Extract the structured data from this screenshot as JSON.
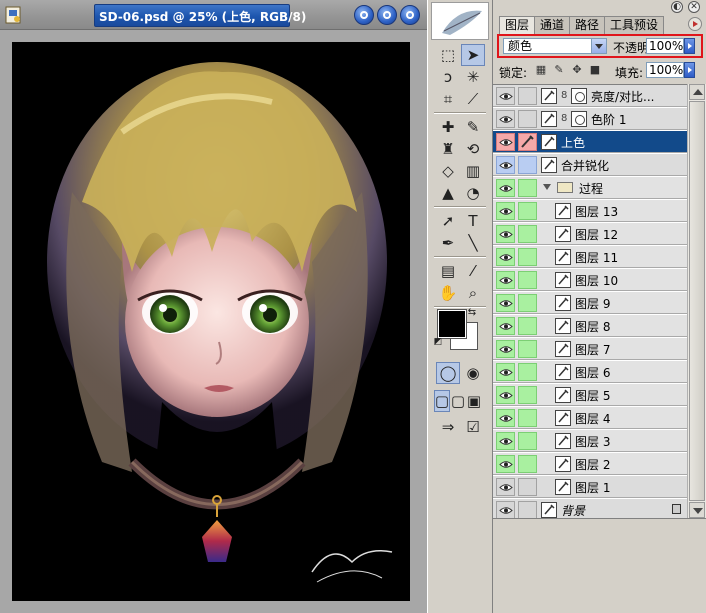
{
  "document": {
    "title": "SD-06.psd @ 25% (上色, RGB/8)"
  },
  "panel": {
    "tabs": [
      {
        "label": "图层"
      },
      {
        "label": "通道"
      },
      {
        "label": "路径"
      },
      {
        "label": "工具预设"
      }
    ],
    "blend_mode": "颜色",
    "opacity_label": "不透明度:",
    "opacity_value": "100%",
    "lock_label": "锁定:",
    "fill_label": "填充:",
    "fill_value": "100%"
  },
  "layers": [
    {
      "name": "亮度/对比...",
      "kind": "adjustment",
      "state": "plain"
    },
    {
      "name": "色阶 1",
      "kind": "adjustment",
      "state": "plain"
    },
    {
      "name": "上色",
      "kind": "layer",
      "state": "selected"
    },
    {
      "name": "合并锐化",
      "kind": "layer",
      "state": "blue"
    },
    {
      "name": "过程",
      "kind": "group",
      "state": "green"
    },
    {
      "name": "图层 13",
      "kind": "layer",
      "state": "green"
    },
    {
      "name": "图层 12",
      "kind": "layer",
      "state": "green"
    },
    {
      "name": "图层 11",
      "kind": "layer",
      "state": "green"
    },
    {
      "name": "图层 10",
      "kind": "layer",
      "state": "green"
    },
    {
      "name": "图层 9",
      "kind": "layer",
      "state": "green"
    },
    {
      "name": "图层 8",
      "kind": "layer",
      "state": "green"
    },
    {
      "name": "图层 7",
      "kind": "layer",
      "state": "green"
    },
    {
      "name": "图层 6",
      "kind": "layer",
      "state": "green"
    },
    {
      "name": "图层 5",
      "kind": "layer",
      "state": "green"
    },
    {
      "name": "图层 4",
      "kind": "layer",
      "state": "green"
    },
    {
      "name": "图层 3",
      "kind": "layer",
      "state": "green"
    },
    {
      "name": "图层 2",
      "kind": "layer",
      "state": "green"
    },
    {
      "name": "图层 1",
      "kind": "layer",
      "state": "plain"
    },
    {
      "name": "背景",
      "kind": "background",
      "state": "plain"
    }
  ],
  "colors": {
    "selected_row": "#124a8a",
    "highlight_box": "#e0151b",
    "visible_green": "#a9f0a0",
    "selected_pink": "#f5a9a9"
  }
}
